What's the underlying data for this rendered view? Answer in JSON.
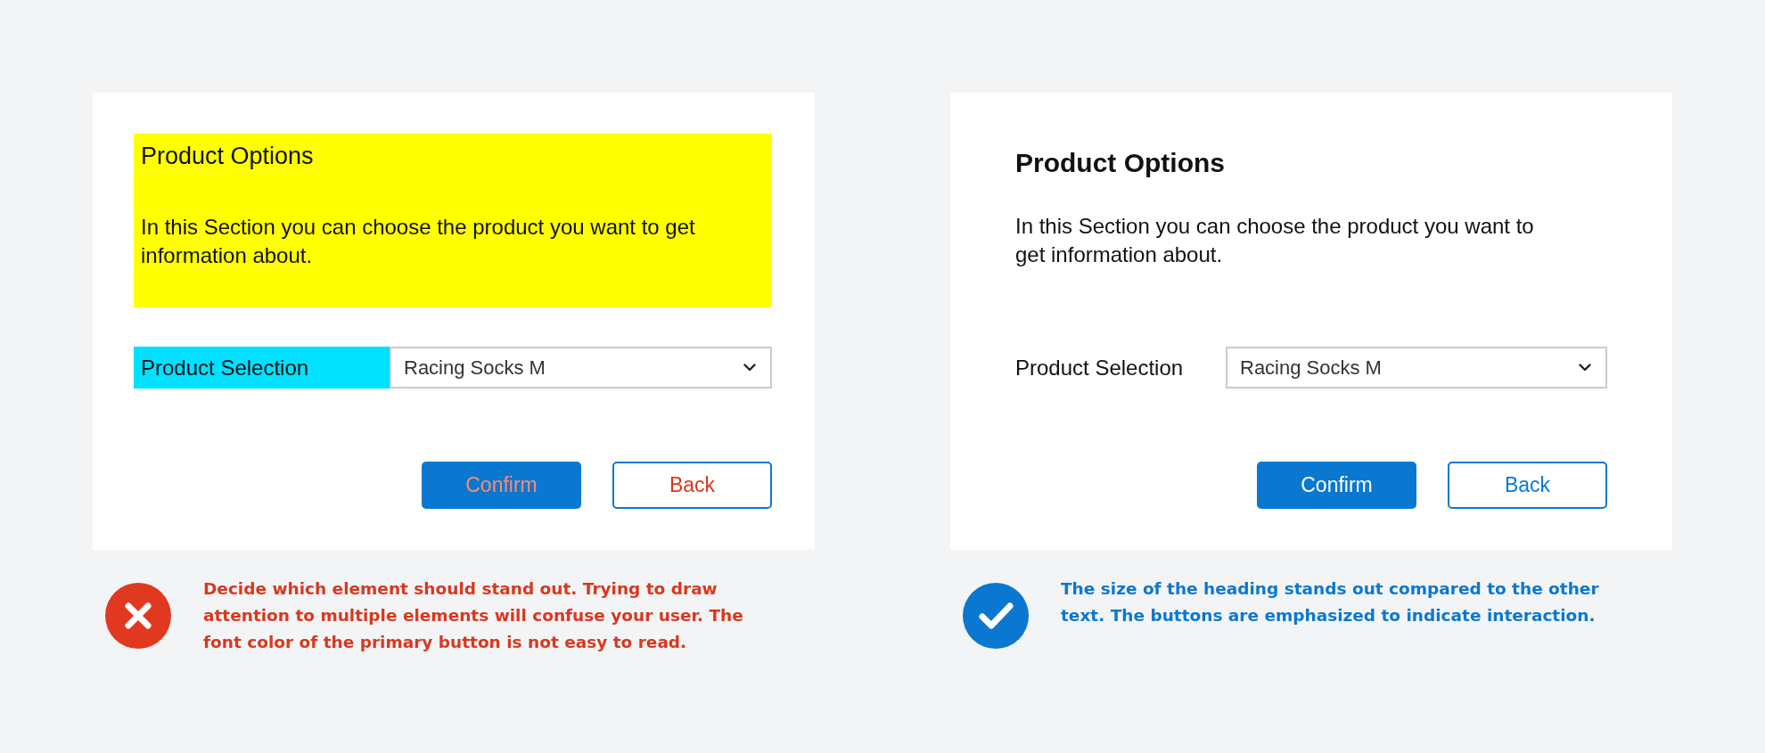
{
  "panels": [
    {
      "kind": "bad",
      "heading": "Product Options",
      "description": "In this Section you can choose the product you want to get information about.",
      "field_label": "Product Selection",
      "select_value": "Racing Socks M",
      "buttons": [
        {
          "kind": "primary",
          "label": "Confirm"
        },
        {
          "kind": "secondary",
          "label": "Back"
        }
      ],
      "caption": "Decide which element should stand out. Trying to draw attention to multiple elements will confuse your user. The font color of the primary button is not easy to read."
    },
    {
      "kind": "good",
      "heading": "Product Options",
      "description": "In this Section you can choose the product you want to get information about.",
      "field_label": "Product Selection",
      "select_value": "Racing Socks M",
      "buttons": [
        {
          "kind": "primary",
          "label": "Confirm"
        },
        {
          "kind": "secondary",
          "label": "Back"
        }
      ],
      "caption": "The size of the heading stands out compared to the other text. The buttons are emphasized to indicate interaction."
    }
  ]
}
